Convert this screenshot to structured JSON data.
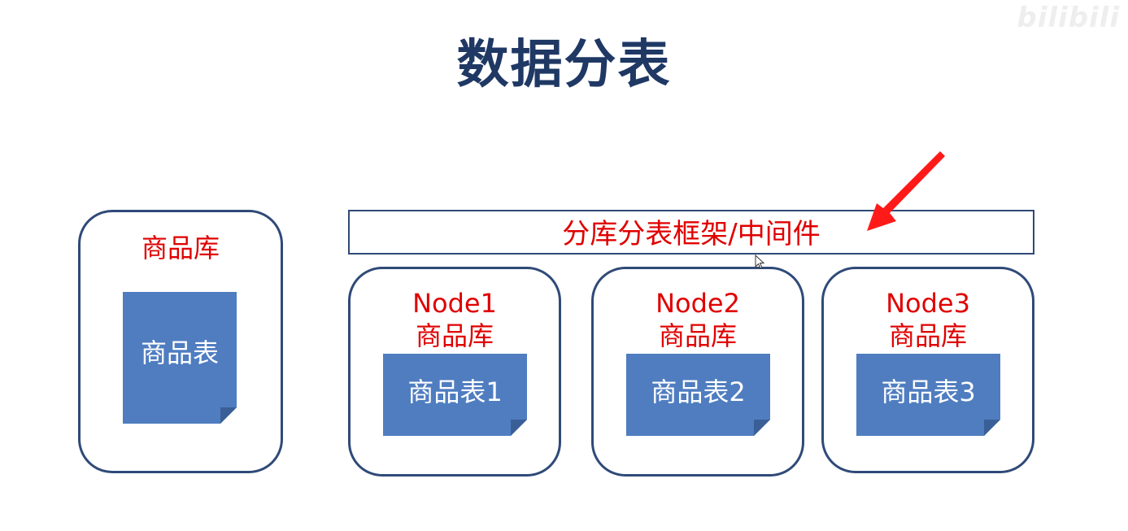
{
  "title": "数据分表",
  "watermark": "bilibili",
  "single_db": {
    "label": "商品库",
    "table_label": "商品表"
  },
  "framework": {
    "label": "分库分表框架/中间件"
  },
  "nodes": [
    {
      "name": "Node1",
      "db_label": "商品库",
      "table_label": "商品表1"
    },
    {
      "name": "Node2",
      "db_label": "商品库",
      "table_label": "商品表2"
    },
    {
      "name": "Node3",
      "db_label": "商品库",
      "table_label": "商品表3"
    }
  ],
  "colors": {
    "title": "#1f3864",
    "label_red": "#e00000",
    "box_border": "#2f4a78",
    "table_fill": "#4f7dc0",
    "arrow": "#ff1a1a"
  },
  "icons": {
    "arrow": "red-pointer-arrow",
    "cursor": "mouse-cursor-icon"
  }
}
